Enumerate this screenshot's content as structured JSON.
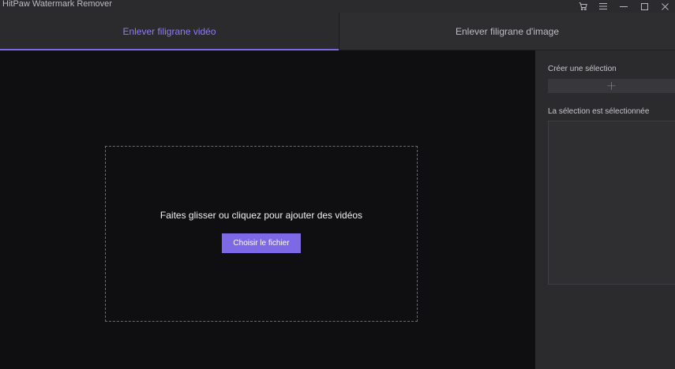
{
  "window": {
    "title": "HitPaw Watermark Remover",
    "controls": [
      "cart-icon",
      "menu-icon",
      "minimize-icon",
      "maximize-icon",
      "close-icon"
    ]
  },
  "tabs": [
    {
      "label": "Enlever filigrane vidéo",
      "active": true
    },
    {
      "label": "Enlever filigrane d'image",
      "active": false
    }
  ],
  "dropzone": {
    "text": "Faites glisser ou cliquez pour ajouter des vidéos",
    "button_label": "Choisir le fichier"
  },
  "panel": {
    "create_label": "Créer une sélection",
    "add_icon": "plus-icon",
    "selected_label": "La sélection est sélectionnée"
  },
  "colors": {
    "accent": "#7d69e6",
    "background": "#0f0f12",
    "panel": "#2b2b2e"
  }
}
